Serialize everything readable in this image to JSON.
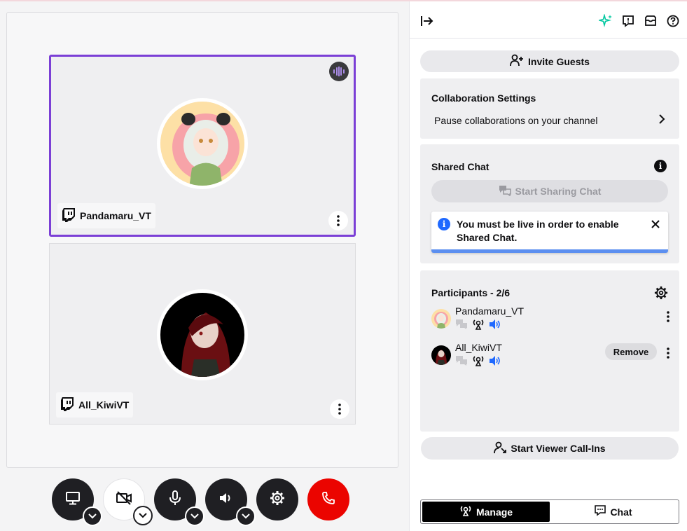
{
  "stage": {
    "participants": [
      {
        "name": "Pandamaru_VT",
        "active": true,
        "speaking_icon": "audio-waves-icon"
      },
      {
        "name": "All_KiwiVT",
        "active": false
      }
    ]
  },
  "controls": [
    {
      "name": "screen-share-button",
      "icon": "monitor-icon",
      "has_menu": true
    },
    {
      "name": "camera-button",
      "icon": "camera-off-icon",
      "has_menu": true
    },
    {
      "name": "microphone-button",
      "icon": "microphone-icon",
      "has_menu": true
    },
    {
      "name": "speaker-button",
      "icon": "speaker-icon",
      "has_menu": true
    },
    {
      "name": "settings-button",
      "icon": "gear-icon",
      "has_menu": false
    },
    {
      "name": "leave-call-button",
      "icon": "phone-hangup-icon",
      "has_menu": false
    }
  ],
  "panel": {
    "invite_label": "Invite Guests",
    "collab": {
      "title": "Collaboration Settings",
      "pause_label": "Pause collaborations on your channel"
    },
    "shared_chat": {
      "title": "Shared Chat",
      "start_label": "Start Sharing Chat",
      "toast": "You must be live in order to enable Shared Chat."
    },
    "participants": {
      "title": "Participants - 2/6",
      "list": [
        {
          "name": "Pandamaru_VT",
          "remove_label": null
        },
        {
          "name": "All_KiwiVT",
          "remove_label": "Remove"
        }
      ]
    },
    "call_ins_label": "Start Viewer Call-Ins",
    "tabs": [
      {
        "label": "Manage",
        "selected": true
      },
      {
        "label": "Chat",
        "selected": false
      }
    ]
  },
  "colors": {
    "accent": "#7b3fd6",
    "sparkle": "#00c8a0",
    "info_blue": "#1f69ff",
    "speaker_blue": "#1f69ff",
    "hangup_red": "#eb0400"
  }
}
